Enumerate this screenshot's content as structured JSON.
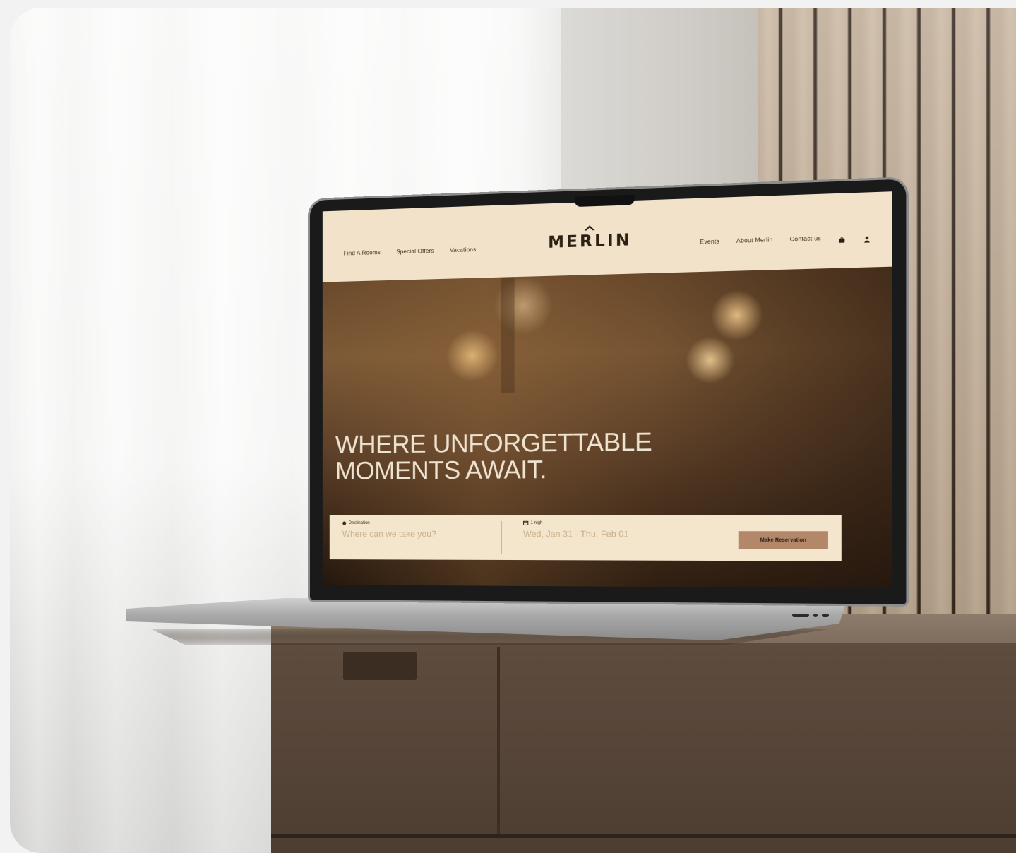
{
  "site": {
    "brand": "MERLIN",
    "brand_mark": "⌂",
    "nav_left": [
      "Find A Rooms",
      "Special Offers",
      "Vacations"
    ],
    "nav_right": [
      "Events",
      "About Merlin",
      "Contact us"
    ],
    "headline_line1": "WHERE UNFORGETTABLE",
    "headline_line2": "MOMENTS AWAIT.",
    "booking": {
      "destination_label": "Destination",
      "destination_placeholder": "Where can we take you?",
      "dates_label": "1 nigh",
      "dates_value": "Wed, Jan 31 - Thu, Feb 01",
      "cta": "Make Reservation"
    },
    "icons": [
      "cart-icon",
      "user-icon",
      "pin-icon",
      "calendar-icon"
    ]
  },
  "colors": {
    "header_bg": "#f1e2c9",
    "cta_bg": "#b3876a",
    "headline": "#eee3d0"
  }
}
